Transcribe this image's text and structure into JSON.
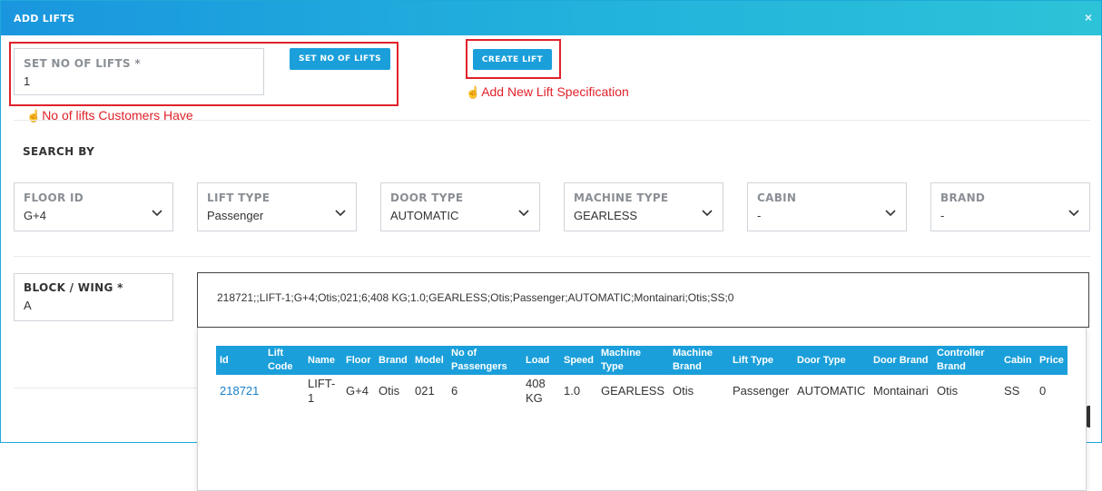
{
  "modal": {
    "title": "ADD LIFTS",
    "close_icon": "×"
  },
  "set_lifts": {
    "label": "SET NO OF LIFTS *",
    "value": "1",
    "button_label": "SET NO OF LIFTS",
    "note": "No of lifts Customers Have"
  },
  "create_lift": {
    "button_label": "CREATE LIFT",
    "note": "Add New Lift Specification"
  },
  "hand_icon": "☝",
  "search_by": {
    "title": "SEARCH BY",
    "filters": [
      {
        "label": "FLOOR ID",
        "value": "G+4"
      },
      {
        "label": "LIFT TYPE",
        "value": "Passenger"
      },
      {
        "label": "DOOR TYPE",
        "value": "AUTOMATIC"
      },
      {
        "label": "MACHINE TYPE",
        "value": "GEARLESS"
      },
      {
        "label": "CABIN",
        "value": "-"
      },
      {
        "label": "BRAND",
        "value": "-"
      }
    ]
  },
  "block_wing": {
    "label": "BLOCK / WING *",
    "value": "A"
  },
  "lift_search": {
    "value": "218721;;LIFT-1;G+4;Otis;021;6;408 KG;1.0;GEARLESS;Otis;Passenger;AUTOMATIC;Montainari;Otis;SS;0"
  },
  "results": {
    "headers": [
      "Id",
      "Lift Code",
      "Name",
      "Floor",
      "Brand",
      "Model",
      "No of Passengers",
      "Load",
      "Speed",
      "Machine Type",
      "Machine Brand",
      "Lift Type",
      "Door Type",
      "Door Brand",
      "Controller Brand",
      "Cabin",
      "Price"
    ],
    "rows": [
      [
        "218721",
        "",
        "LIFT-1",
        "G+4",
        "Otis",
        "021",
        "6",
        "408 KG",
        "1.0",
        "GEARLESS",
        "Otis",
        "Passenger",
        "AUTOMATIC",
        "Montainari",
        "Otis",
        "SS",
        "0"
      ]
    ]
  },
  "colors": {
    "header_gradient_start": "#1a96de",
    "accent": "#1a9fda",
    "highlight_red": "#e0222b",
    "link": "#1a7fc7"
  }
}
